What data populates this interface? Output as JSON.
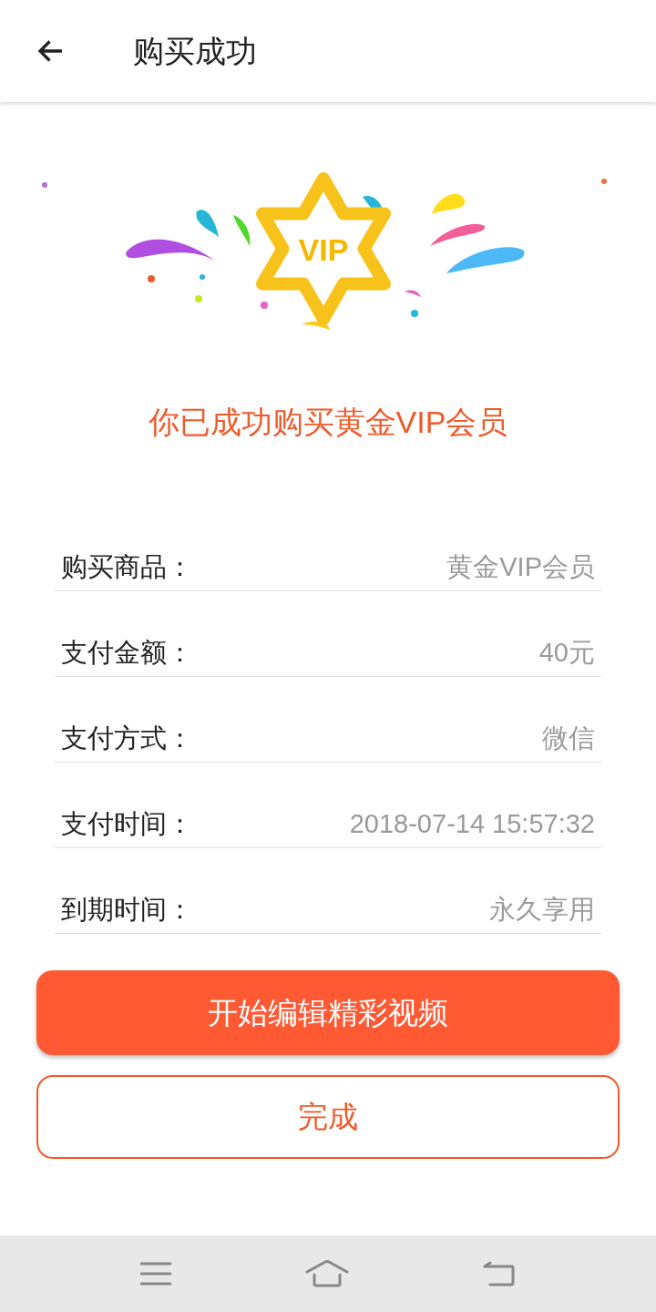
{
  "header": {
    "title": "购买成功"
  },
  "badge": {
    "text": "VIP"
  },
  "message": "你已成功购买黄金VIP会员",
  "details": [
    {
      "label": "购买商品：",
      "value": "黄金VIP会员"
    },
    {
      "label": "支付金额：",
      "value": "40元"
    },
    {
      "label": "支付方式：",
      "value": "微信"
    },
    {
      "label": "支付时间：",
      "value": "2018-07-14 15:57:32"
    },
    {
      "label": "到期时间：",
      "value": "永久享用"
    }
  ],
  "buttons": [
    {
      "label": "开始编辑精彩视频",
      "kind": "primary"
    },
    {
      "label": "完成",
      "kind": "outline"
    }
  ]
}
